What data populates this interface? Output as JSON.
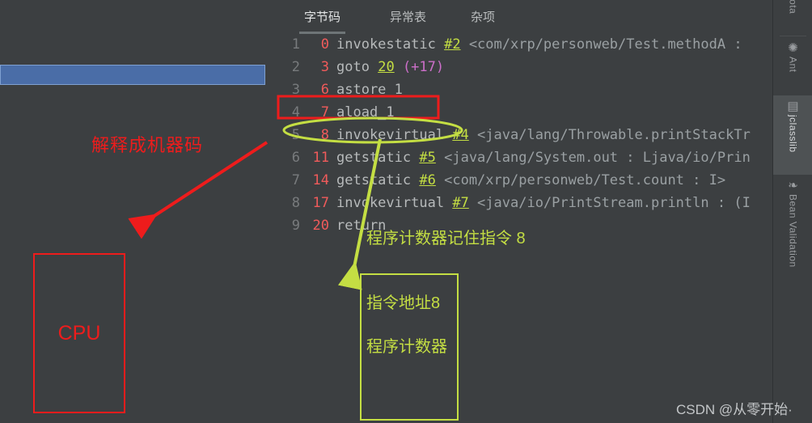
{
  "editor": {
    "tabs": [
      {
        "label": "字节码",
        "active": true
      },
      {
        "label": "异常表",
        "active": false
      },
      {
        "label": "杂项",
        "active": false
      }
    ],
    "code_lines": [
      {
        "line_no": "1",
        "offset": "0",
        "mnemonic": "invokestatic",
        "operand": "#2",
        "operand_kind": "cpref",
        "delta": "",
        "description": "<com/xrp/personweb/Test.methodA :"
      },
      {
        "line_no": "2",
        "offset": "3",
        "mnemonic": "goto",
        "operand": "20",
        "operand_kind": "branch",
        "delta": "(+17)",
        "description": ""
      },
      {
        "line_no": "3",
        "offset": "6",
        "mnemonic": "astore_1",
        "operand": "",
        "operand_kind": "",
        "delta": "",
        "description": ""
      },
      {
        "line_no": "4",
        "offset": "7",
        "mnemonic": "aload_1",
        "operand": "",
        "operand_kind": "",
        "delta": "",
        "description": ""
      },
      {
        "line_no": "5",
        "offset": "8",
        "mnemonic": "invokevirtual",
        "operand": "#4",
        "operand_kind": "cpref",
        "delta": "",
        "description": "<java/lang/Throwable.printStackTr"
      },
      {
        "line_no": "6",
        "offset": "11",
        "mnemonic": "getstatic",
        "operand": "#5",
        "operand_kind": "cpref",
        "delta": "",
        "description": "<java/lang/System.out : Ljava/io/Prin"
      },
      {
        "line_no": "7",
        "offset": "14",
        "mnemonic": "getstatic",
        "operand": "#6",
        "operand_kind": "cpref",
        "delta": "",
        "description": "<com/xrp/personweb/Test.count : I>"
      },
      {
        "line_no": "8",
        "offset": "17",
        "mnemonic": "invokevirtual",
        "operand": "#7",
        "operand_kind": "cpref",
        "delta": "",
        "description": "<java/io/PrintStream.println : (I"
      },
      {
        "line_no": "9",
        "offset": "20",
        "mnemonic": "return",
        "operand": "",
        "operand_kind": "",
        "delta": "",
        "description": ""
      }
    ]
  },
  "annotations": {
    "interpret_label": "解释成机器码",
    "cpu_label": "CPU",
    "pc_note": "程序计数器记住指令 8",
    "pc_box_line1": "指令地址8",
    "pc_box_line2": "程序计数器",
    "highlight_red_target": "aload_1",
    "highlight_green_target": "invokevirtual",
    "colors": {
      "red": "#ee1c1c",
      "green": "#c4de43",
      "blue_bar": "#4a6da7",
      "editor_background": "#3c3f41",
      "mnemonic": "#b7babb",
      "offset": "#f05b5b",
      "line_number": "#787b7d",
      "delta": "#cc6fc9",
      "description": "#9aa0a3"
    }
  },
  "right_sidebar": {
    "tabs": [
      {
        "label": "dota",
        "icon": "dot-icon",
        "glyph": "",
        "active": false
      },
      {
        "label": "Ant",
        "icon": "ant-icon",
        "glyph": "✺",
        "active": false
      },
      {
        "label": "jclasslib",
        "icon": "jclasslib-icon",
        "glyph": "▤",
        "active": true
      },
      {
        "label": "Bean Validation",
        "icon": "bean-validation-icon",
        "glyph": "❧",
        "active": false
      }
    ]
  },
  "watermark": {
    "text": "CSDN @从零开始·"
  }
}
